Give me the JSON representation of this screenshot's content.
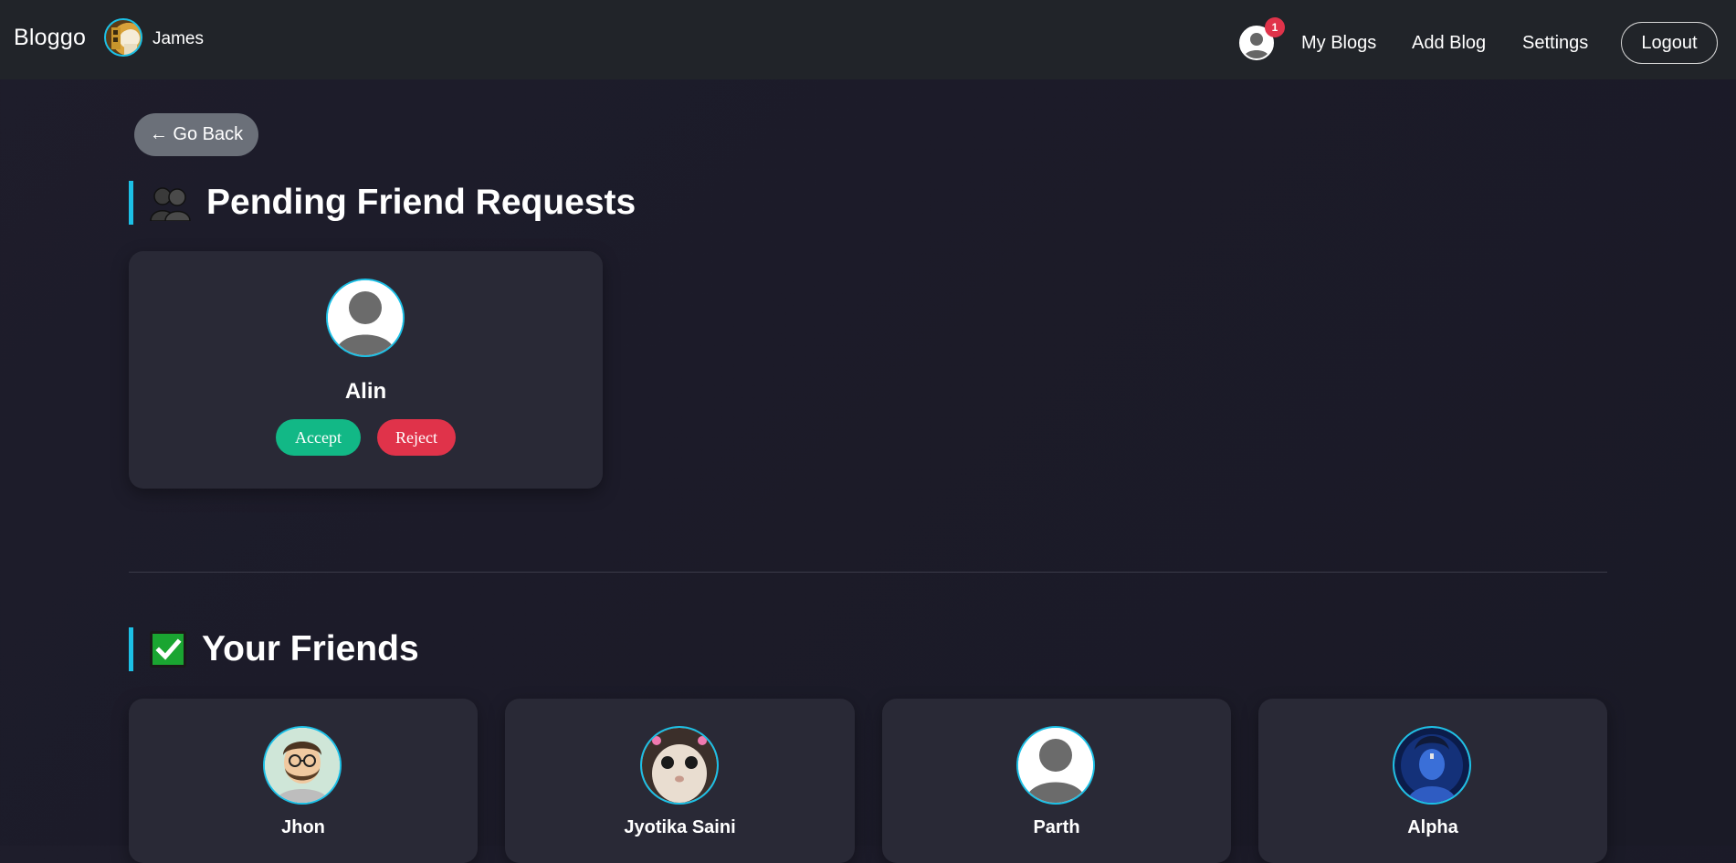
{
  "navbar": {
    "brand": "Bloggo",
    "user_name": "James",
    "notification_count": "1",
    "links": [
      "My Blogs",
      "Add Blog",
      "Settings"
    ],
    "logout_label": "Logout"
  },
  "go_back_label": "← Go Back",
  "pending": {
    "title": "Pending Friend Requests",
    "requests": [
      {
        "name": "Alin",
        "accept_label": "Accept",
        "reject_label": "Reject"
      }
    ]
  },
  "friends": {
    "title": "Your Friends",
    "list": [
      {
        "name": "Jhon",
        "avatar": "cartoon-man-avatar"
      },
      {
        "name": "Jyotika Saini",
        "avatar": "cat-photo-avatar"
      },
      {
        "name": "Parth",
        "avatar": "default-avatar"
      },
      {
        "name": "Alpha",
        "avatar": "blue-deity-avatar"
      }
    ]
  },
  "colors": {
    "accent": "#1cc0e6",
    "accept": "#12b886",
    "reject": "#e0334a",
    "card": "#292936",
    "navbar": "#212429"
  }
}
